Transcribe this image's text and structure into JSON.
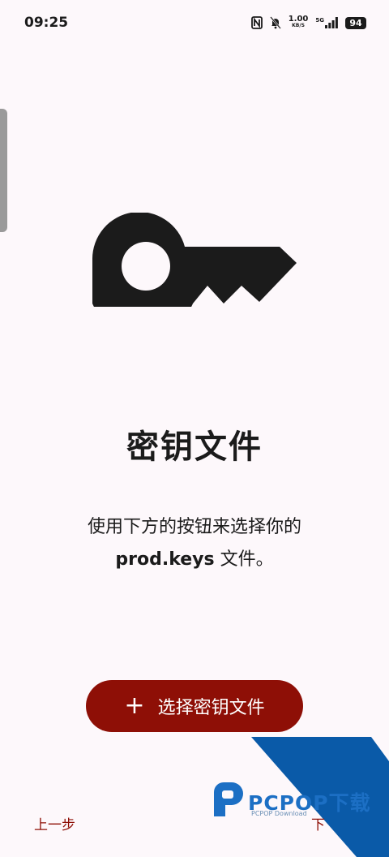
{
  "status_bar": {
    "time": "09:25",
    "net_speed_value": "1.00",
    "net_speed_unit": "KB/S",
    "network": "5G",
    "battery": "94"
  },
  "main": {
    "icon": "key-icon",
    "title": "密钥文件",
    "description_line1": "使用下方的按钮来选择你的",
    "description_filename": "prod.keys",
    "description_suffix": " 文件。"
  },
  "button": {
    "icon": "plus-icon",
    "label": "选择密钥文件"
  },
  "navigation": {
    "back_label": "上一步",
    "next_label": "下"
  },
  "watermark": {
    "brand": "PCPOP下载",
    "sub": "PCPOP Download"
  },
  "colors": {
    "accent": "#8e0f06",
    "background": "#fdf8fb",
    "watermark_blue": "#0a5aa8"
  }
}
